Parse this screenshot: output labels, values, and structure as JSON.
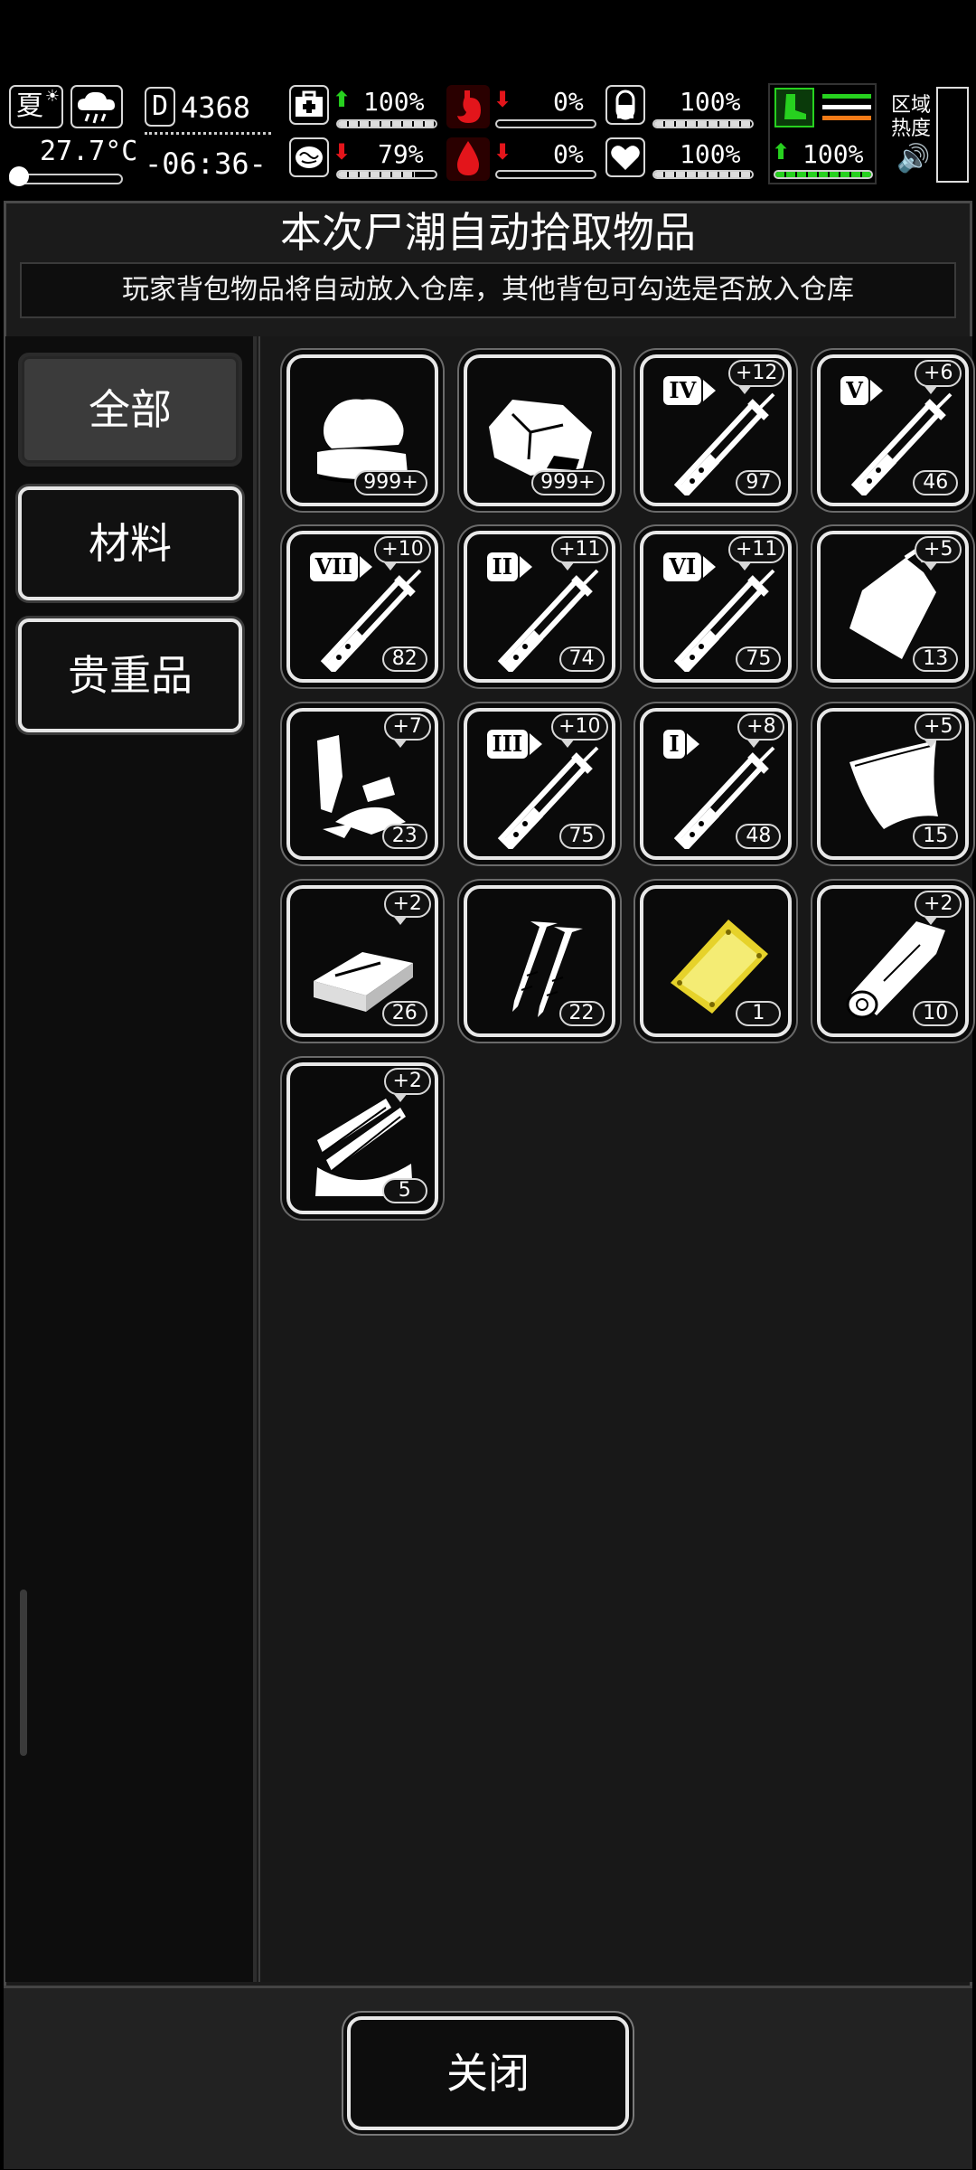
{
  "hud": {
    "season": "夏",
    "temperature": "27.7°C",
    "day_counter": "4368",
    "day_icon_text": "D",
    "clock": "-06:36-",
    "stats": {
      "health": "100%",
      "brain": "79%",
      "stomach": "0%",
      "blood": "0%",
      "pill": "100%",
      "heart": "100%",
      "stamina": "100%"
    },
    "stat_fill": {
      "health": 1.0,
      "brain": 0.79,
      "stomach": 0.0,
      "blood": 0.0,
      "pill": 1.0,
      "heart": 1.0,
      "stamina": 1.0
    },
    "zone_heat_label_1": "区域",
    "zone_heat_label_2": "热度",
    "colors": {
      "accent_green": "#27d11f",
      "danger_red": "#e3151b",
      "line_orange": "#f27a17"
    }
  },
  "panel": {
    "title": "本次尸潮自动拾取物品",
    "subtitle": "玩家背包物品将自动放入仓库，其他背包可勾选是否放入仓库"
  },
  "tabs": [
    {
      "label": "全部",
      "active": true
    },
    {
      "label": "材料",
      "active": false
    },
    {
      "label": "贵重品",
      "active": false
    }
  ],
  "items": [
    {
      "icon": "cloth-icon",
      "count": "999+",
      "badge": "",
      "roman": ""
    },
    {
      "icon": "stone-icon",
      "count": "999+",
      "badge": "",
      "roman": ""
    },
    {
      "icon": "syringe-iv-icon",
      "count": "97",
      "badge": "+12",
      "roman": "IV"
    },
    {
      "icon": "syringe-v-icon",
      "count": "46",
      "badge": "+6",
      "roman": "V"
    },
    {
      "icon": "syringe-vii-icon",
      "count": "82",
      "badge": "+10",
      "roman": "VII"
    },
    {
      "icon": "syringe-ii-icon",
      "count": "74",
      "badge": "+11",
      "roman": "II"
    },
    {
      "icon": "syringe-vi-icon",
      "count": "75",
      "badge": "+11",
      "roman": "VI"
    },
    {
      "icon": "plastic-bag-icon",
      "count": "13",
      "badge": "+5",
      "roman": ""
    },
    {
      "icon": "scrap-parts-icon",
      "count": "23",
      "badge": "+7",
      "roman": ""
    },
    {
      "icon": "syringe-iii-icon",
      "count": "75",
      "badge": "+10",
      "roman": "III"
    },
    {
      "icon": "syringe-i-icon",
      "count": "48",
      "badge": "+8",
      "roman": "I"
    },
    {
      "icon": "leather-sheet-icon",
      "count": "15",
      "badge": "+5",
      "roman": ""
    },
    {
      "icon": "brick-icon",
      "count": "26",
      "badge": "+2",
      "roman": ""
    },
    {
      "icon": "nails-icon",
      "count": "22",
      "badge": "",
      "roman": ""
    },
    {
      "icon": "gold-plate-icon",
      "count": "1",
      "badge": "",
      "roman": ""
    },
    {
      "icon": "wood-log-icon",
      "count": "10",
      "badge": "+2",
      "roman": ""
    },
    {
      "icon": "wood-planks-icon",
      "count": "5",
      "badge": "+2",
      "roman": ""
    }
  ],
  "footer": {
    "close_label": "关闭"
  }
}
